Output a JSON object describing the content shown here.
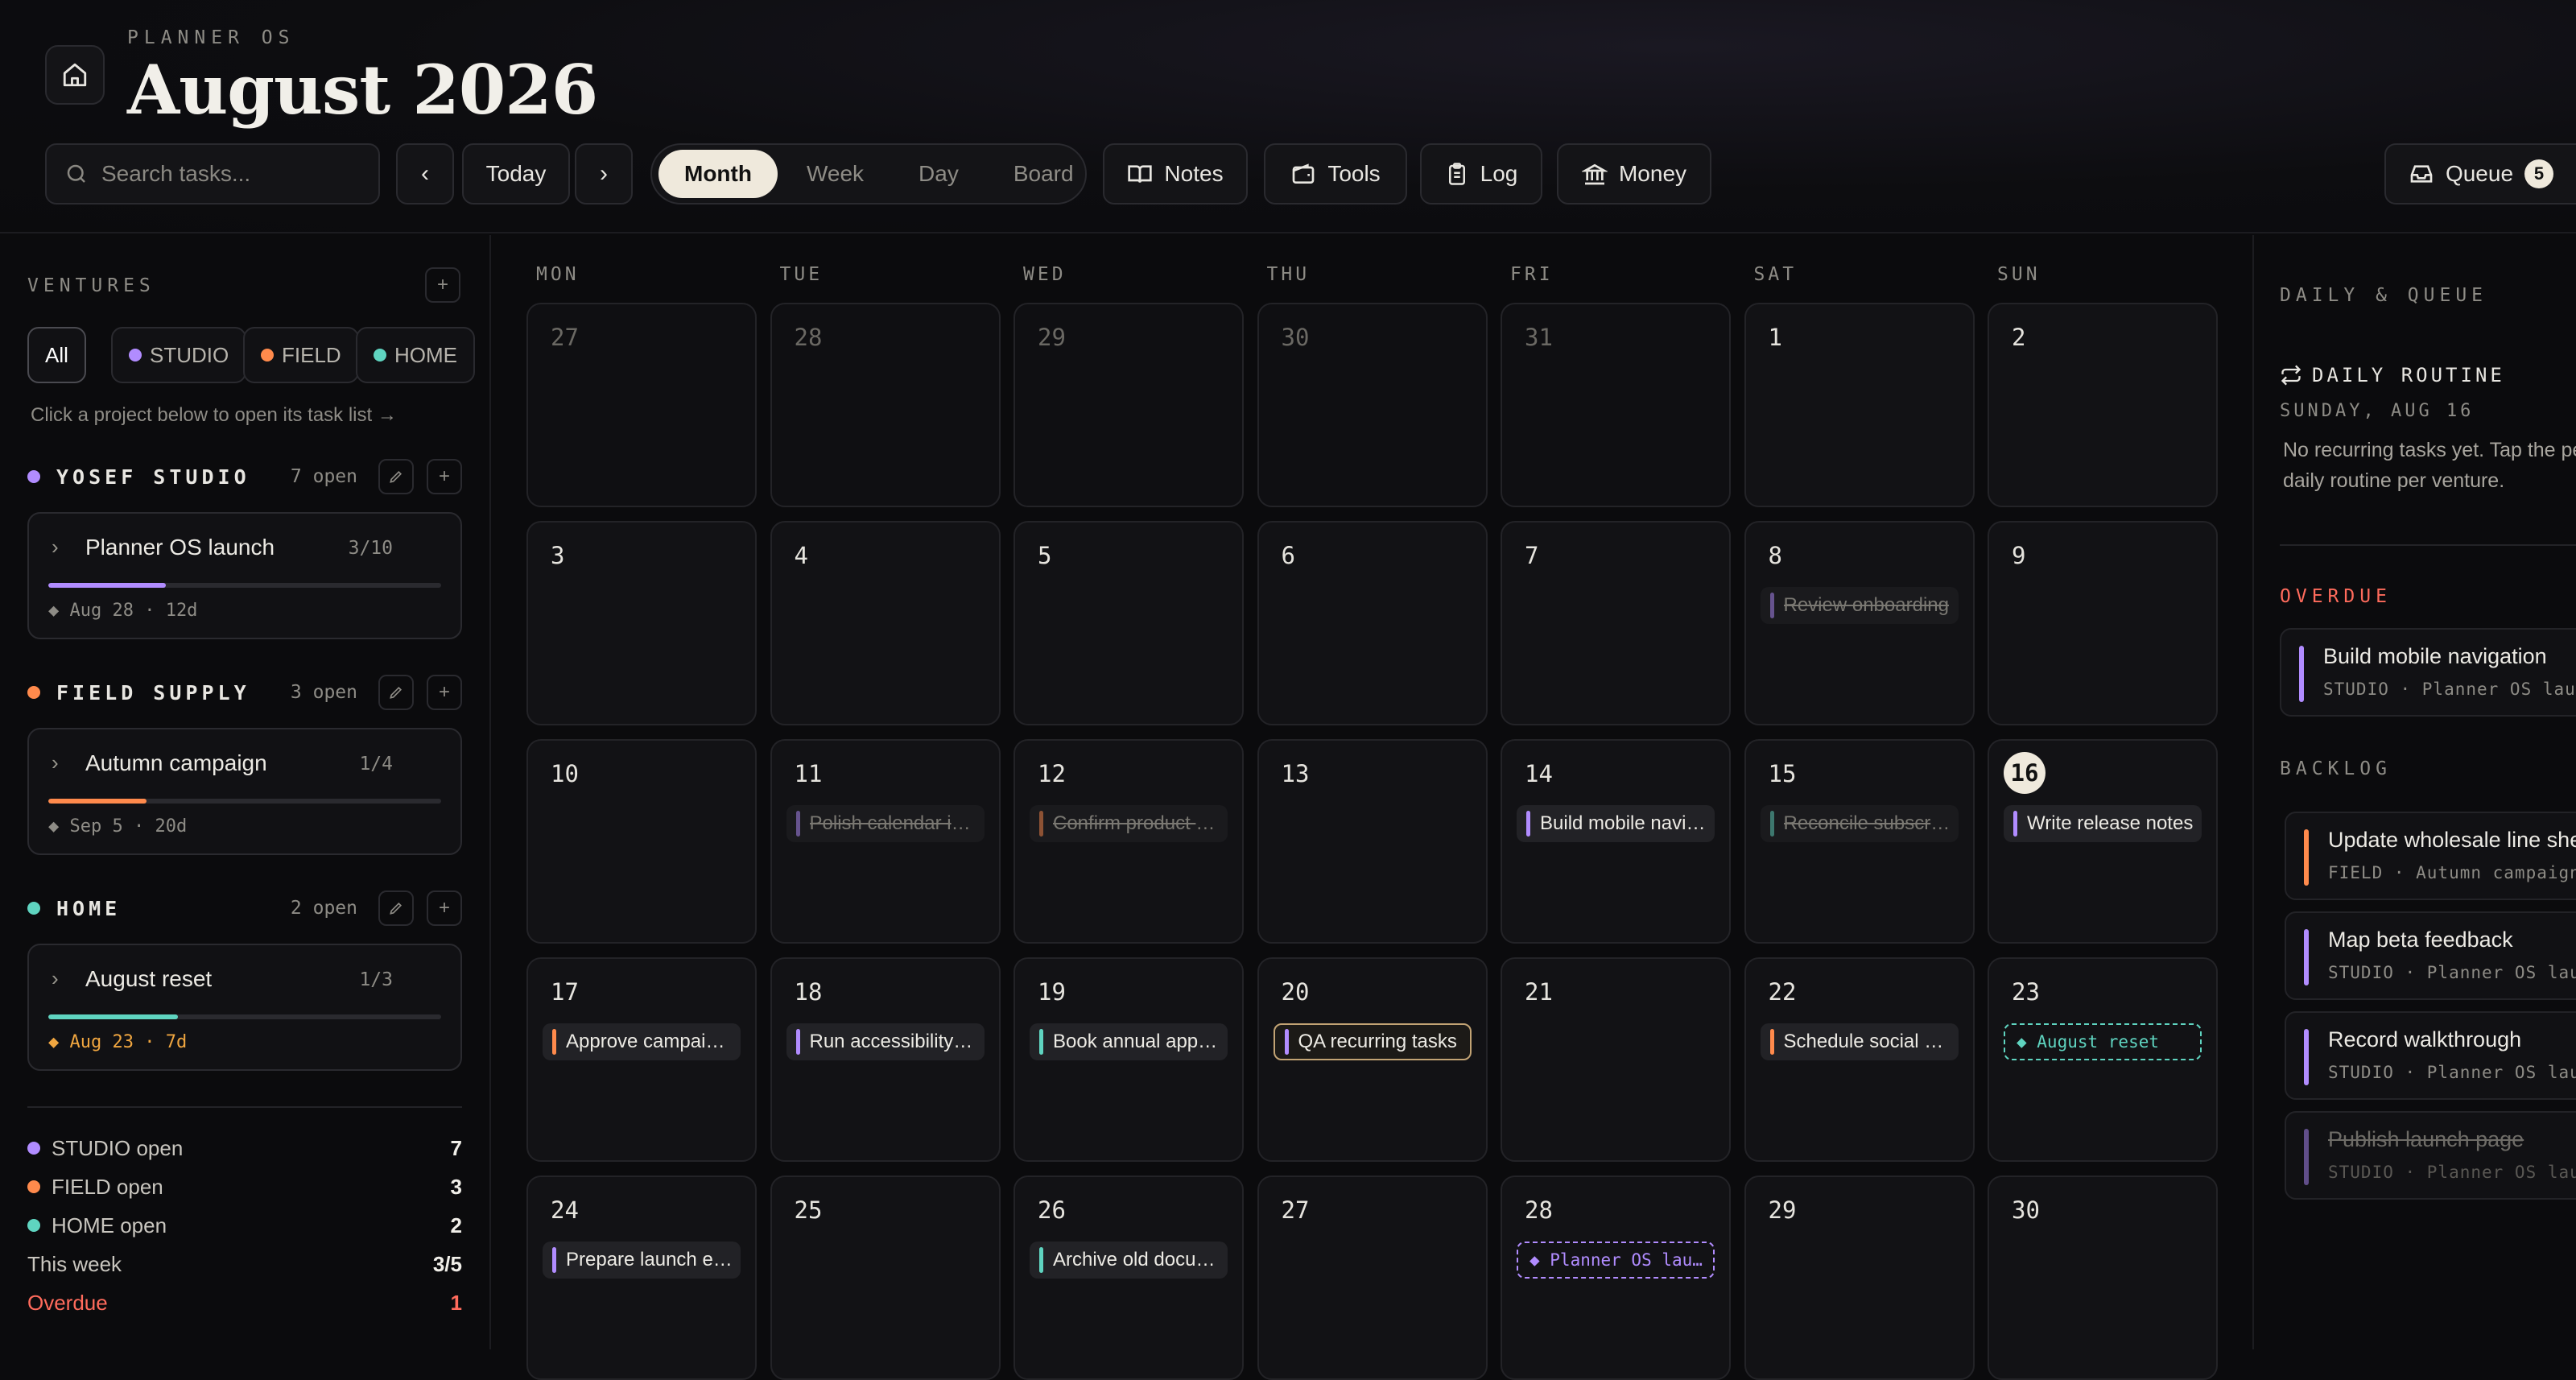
{
  "app": {
    "brand": "PLANNER OS",
    "title": "August 2026"
  },
  "search": {
    "placeholder": "Search tasks..."
  },
  "nav": {
    "today": "Today"
  },
  "views": [
    "Month",
    "Week",
    "Day",
    "Board"
  ],
  "active_view": "Month",
  "tools": {
    "notes": "Notes",
    "tools": "Tools",
    "log": "Log",
    "money": "Money",
    "queue": "Queue",
    "queue_count": "5"
  },
  "sidebar": {
    "label": "VENTURES",
    "filters": [
      {
        "label": "All",
        "color": ""
      },
      {
        "label": "STUDIO",
        "color": "#b18cff"
      },
      {
        "label": "FIELD",
        "color": "#ff8a4c"
      },
      {
        "label": "HOME",
        "color": "#5fd4c0"
      }
    ],
    "hint": "Click a project below to open its task list →",
    "groups": [
      {
        "name": "YOSEF STUDIO",
        "open": "7 open",
        "color": "#b18cff",
        "project": {
          "name": "Planner OS launch",
          "count": "3/10",
          "progress": 0.3,
          "meta": "◆ Aug 28 · 12d",
          "meta_color": "#8e8c86"
        }
      },
      {
        "name": "FIELD SUPPLY",
        "open": "3 open",
        "color": "#ff8a4c",
        "project": {
          "name": "Autumn campaign",
          "count": "1/4",
          "progress": 0.25,
          "meta": "◆ Sep 5 · 20d",
          "meta_color": "#8e8c86"
        }
      },
      {
        "name": "HOME",
        "open": "2 open",
        "color": "#5fd4c0",
        "project": {
          "name": "August reset",
          "count": "1/3",
          "progress": 0.33,
          "meta": "◆ Aug 23 · 7d",
          "meta_color": "#f0a640"
        }
      }
    ],
    "stats": [
      {
        "label": "STUDIO open",
        "value": "7",
        "color": "#b18cff"
      },
      {
        "label": "FIELD open",
        "value": "3",
        "color": "#ff8a4c"
      },
      {
        "label": "HOME open",
        "value": "2",
        "color": "#5fd4c0"
      },
      {
        "label": "This week",
        "value": "3/5",
        "color": ""
      },
      {
        "label": "Overdue",
        "value": "1",
        "color": "",
        "alert": true
      }
    ]
  },
  "calendar": {
    "weekdays": [
      "MON",
      "TUE",
      "WED",
      "THU",
      "FRI",
      "SAT",
      "SUN"
    ],
    "weeks": [
      [
        {
          "d": "27",
          "m": true
        },
        {
          "d": "28",
          "m": true
        },
        {
          "d": "29",
          "m": true
        },
        {
          "d": "30",
          "m": true
        },
        {
          "d": "31",
          "m": true
        },
        {
          "d": "1"
        },
        {
          "d": "2"
        }
      ],
      [
        {
          "d": "3"
        },
        {
          "d": "4"
        },
        {
          "d": "5"
        },
        {
          "d": "6"
        },
        {
          "d": "7"
        },
        {
          "d": "8",
          "task": {
            "t": "Review onboarding",
            "c": "#b18cff",
            "done": true
          }
        },
        {
          "d": "9"
        }
      ],
      [
        {
          "d": "10"
        },
        {
          "d": "11",
          "task": {
            "t": "Polish calendar interactions",
            "c": "#b18cff",
            "done": true
          }
        },
        {
          "d": "12",
          "task": {
            "t": "Confirm product photos",
            "c": "#ff8a4c",
            "done": true
          }
        },
        {
          "d": "13"
        },
        {
          "d": "14",
          "task": {
            "t": "Build mobile navigation",
            "c": "#b18cff"
          }
        },
        {
          "d": "15",
          "task": {
            "t": "Reconcile subscriptions",
            "c": "#5fd4c0",
            "done": true
          }
        },
        {
          "d": "16",
          "today": true,
          "task": {
            "t": "Write release notes",
            "c": "#b18cff"
          }
        }
      ],
      [
        {
          "d": "17",
          "task": {
            "t": "Approve campaign brief",
            "c": "#ff8a4c"
          }
        },
        {
          "d": "18",
          "task": {
            "t": "Run accessibility audit",
            "c": "#b18cff"
          }
        },
        {
          "d": "19",
          "task": {
            "t": "Book annual appointment",
            "c": "#5fd4c0"
          }
        },
        {
          "d": "20",
          "task": {
            "t": "QA recurring tasks",
            "c": "#b18cff",
            "outline": true
          }
        },
        {
          "d": "21"
        },
        {
          "d": "22",
          "task": {
            "t": "Schedule social posts",
            "c": "#ff8a4c"
          }
        },
        {
          "d": "23",
          "milestone": {
            "t": "◆ August reset",
            "c": "#5fd4c0"
          }
        }
      ],
      [
        {
          "d": "24",
          "task": {
            "t": "Prepare launch email",
            "c": "#b18cff"
          }
        },
        {
          "d": "25"
        },
        {
          "d": "26",
          "task": {
            "t": "Archive old documents",
            "c": "#5fd4c0"
          }
        },
        {
          "d": "27"
        },
        {
          "d": "28",
          "milestone": {
            "t": "◆ Planner OS launch",
            "c": "#b18cff"
          }
        },
        {
          "d": "29"
        },
        {
          "d": "30"
        }
      ]
    ]
  },
  "right": {
    "label": "DAILY & QUEUE",
    "routine_label": "DAILY ROUTINE",
    "routine_date": "SUNDAY, AUG 16",
    "routine_empty": "No recurring tasks yet. Tap the pencil to set up a daily routine per venture.",
    "overdue_label": "OVERDUE",
    "overdue": [
      {
        "title": "Build mobile navigation",
        "sub": "STUDIO · Planner OS launch",
        "color": "#b18cff"
      }
    ],
    "backlog_label": "BACKLOG",
    "backlog": [
      {
        "title": "Update wholesale line sheet",
        "sub": "FIELD · Autumn campaign",
        "color": "#ff8a4c"
      },
      {
        "title": "Map beta feedback",
        "sub": "STUDIO · Planner OS launch",
        "color": "#b18cff"
      },
      {
        "title": "Record walkthrough",
        "sub": "STUDIO · Planner OS launch",
        "color": "#b18cff"
      },
      {
        "title": "Publish launch page",
        "sub": "STUDIO · Planner OS launch",
        "color": "#b18cff",
        "done": true
      }
    ]
  },
  "colors": {
    "accent": "#efe9dc",
    "studio": "#b18cff",
    "field": "#ff8a4c",
    "home": "#5fd4c0",
    "overdue": "#ff6b5c"
  }
}
